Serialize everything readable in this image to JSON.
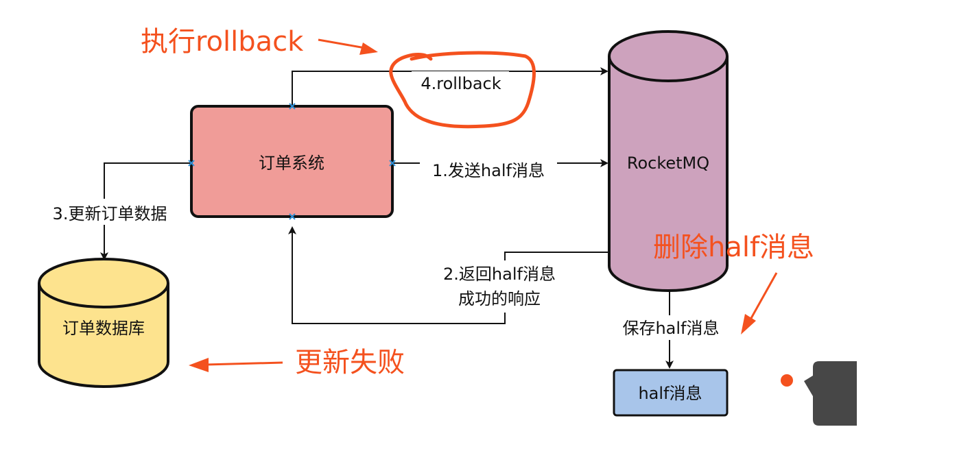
{
  "colors": {
    "order_system_fill": "#f09c98",
    "rocketmq_fill": "#cda2bd",
    "order_db_fill": "#fde38e",
    "half_msg_fill": "#a8c5ea",
    "annotation": "#f4511e",
    "connector_marker": "#2e8fd6",
    "widget": "#474747"
  },
  "nodes": {
    "order_system": "订单系统",
    "rocketmq": "RocketMQ",
    "order_db": "订单数据库",
    "half_message": "half消息"
  },
  "edges": {
    "send_half": "1.发送half消息",
    "return_half_line1": "2.返回half消息",
    "return_half_line2": "成功的响应",
    "update_order": "3.更新订单数据",
    "rollback": "4.rollback",
    "save_half": "保存half消息"
  },
  "annotations": {
    "execute_rollback": "执行rollback",
    "delete_half": "删除half消息",
    "update_failed": "更新失败"
  }
}
